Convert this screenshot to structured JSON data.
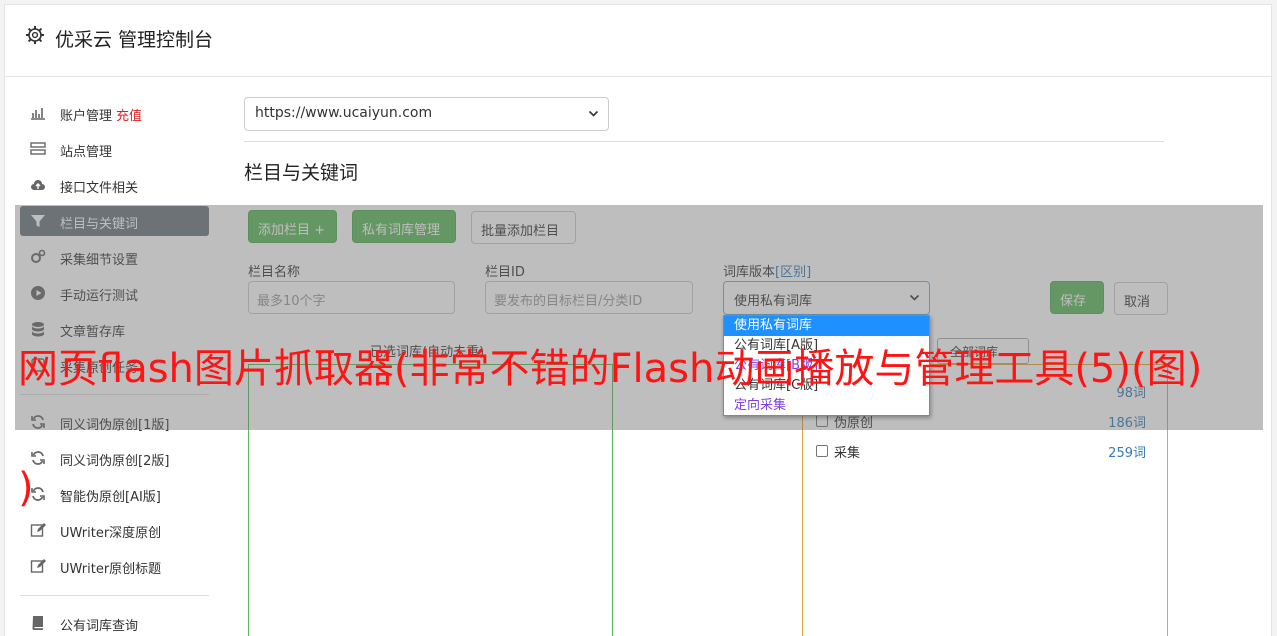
{
  "header": {
    "title": "优采云 管理控制台",
    "icon": "gear-icon"
  },
  "sidebar": {
    "items": [
      {
        "label": "账户管理",
        "extra": "充值",
        "icon": "bar-chart-icon"
      },
      {
        "label": "站点管理",
        "icon": "server-icon"
      },
      {
        "label": "接口文件相关",
        "icon": "cloud-upload-icon"
      },
      {
        "label": "栏目与关键词",
        "icon": "filter-icon",
        "active": true
      },
      {
        "label": "采集细节设置",
        "icon": "cogs-icon"
      },
      {
        "label": "手动运行测试",
        "icon": "play-circle-icon"
      },
      {
        "label": "文章暂存库",
        "icon": "database-icon"
      },
      {
        "label": "采集原创任务",
        "icon": "task-icon"
      },
      {
        "label": "同义词伪原创[1版]",
        "icon": "refresh-icon"
      },
      {
        "label": "同义词伪原创[2版]",
        "icon": "refresh-icon"
      },
      {
        "label": "智能伪原创[AI版]",
        "icon": "refresh-icon"
      },
      {
        "label": "UWriter深度原创",
        "icon": "edit-icon"
      },
      {
        "label": "UWriter原创标题",
        "icon": "edit-icon"
      },
      {
        "label": "公有词库查询",
        "icon": "book-icon"
      }
    ]
  },
  "main": {
    "site_select": "https://www.ucaiyun.com",
    "section_title": "栏目与关键词",
    "buttons": {
      "add_column": "添加栏目 +",
      "private_lib": "私有词库管理",
      "batch_add": "批量添加栏目",
      "save": "保存",
      "cancel": "取消"
    },
    "form": {
      "column_name_label": "栏目名称",
      "column_name_placeholder": "最多10个字",
      "column_id_label": "栏目ID",
      "column_id_placeholder": "要发布的目标栏目/分类ID",
      "lib_version_label": "词库版本",
      "lib_version_link": "[区别]",
      "lib_version_value": "使用私有词库"
    },
    "dropdown_options": [
      "使用私有词库",
      "公有词库[A版]",
      "公有词库[B版]",
      "公有词库[C版]",
      "定向采集"
    ],
    "selected_caption": "已选词库(自动去重)",
    "filter_select": "全部词库",
    "libraries": [
      {
        "name": "",
        "count": "98词"
      },
      {
        "name": "伪原创",
        "count": "186词"
      },
      {
        "name": "采集",
        "count": "259词"
      }
    ]
  },
  "watermark": {
    "line1": "网页flash图片抓取器(非常不错的Flash动画播放与管理工具(5)(图)",
    "line2": ")"
  },
  "colors": {
    "green": "#5cb85c",
    "active_nav": "#6c757d",
    "recharge": "#e02020",
    "watermark": "#ff1414"
  }
}
